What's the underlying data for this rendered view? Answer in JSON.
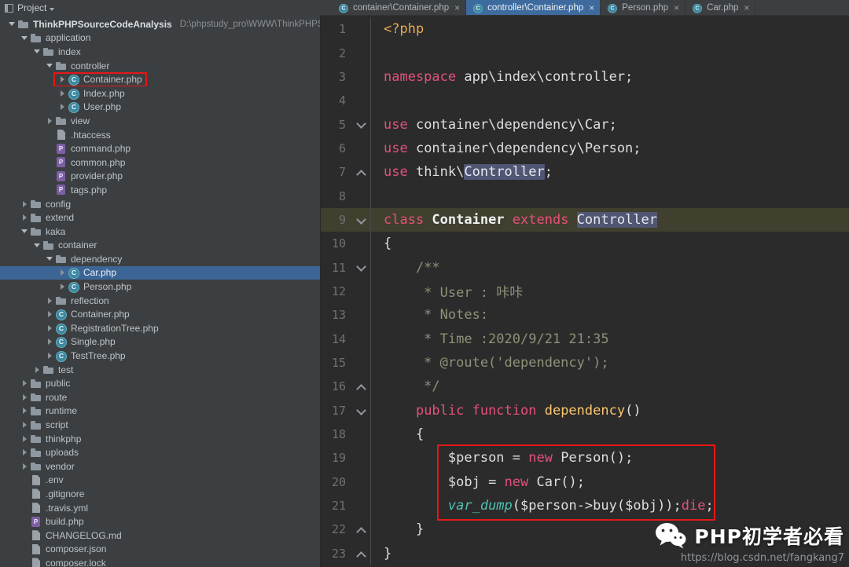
{
  "colors": {
    "editor_bg": "#2b2b2b",
    "panel_bg": "#3c3f41",
    "active_tab": "#3e6b9e",
    "tree_selection": "#3c6595",
    "current_line": "#413f2d",
    "occurrence": "#505673",
    "keyword": "#e4517b",
    "php_tag": "#e9a852",
    "comment": "#8f9178",
    "function_name": "#fdc66e",
    "builtin": "#4fc0b2",
    "code_text": "#dcdee1",
    "annotation_red": "#e61717"
  },
  "project_panel": {
    "title": "Project",
    "header_icons": [
      {
        "name": "locate-icon",
        "glyph": "⊙"
      },
      {
        "name": "collapse-all-icon",
        "glyph": "÷"
      },
      {
        "name": "settings-gear-icon",
        "glyph": "⚙"
      },
      {
        "name": "hide-panel-icon",
        "glyph": "—"
      }
    ]
  },
  "tabs": [
    {
      "label": "container\\Container.php",
      "active": false
    },
    {
      "label": "controller\\Container.php",
      "active": true
    },
    {
      "label": "Person.php",
      "active": false
    },
    {
      "label": "Car.php",
      "active": false
    }
  ],
  "tree": {
    "items": [
      {
        "label": "ThinkPHPSourceCodeAnalysis",
        "suffix": "D:\\phpstudy_pro\\WWW\\ThinkPHPSourceCo",
        "level": 0,
        "icon": "folder",
        "arrow": "down",
        "bold": true
      },
      {
        "label": "application",
        "level": 1,
        "icon": "folder",
        "arrow": "down"
      },
      {
        "label": "index",
        "level": 2,
        "icon": "folder",
        "arrow": "down"
      },
      {
        "label": "controller",
        "level": 3,
        "icon": "folder",
        "arrow": "down"
      },
      {
        "label": "Container.php",
        "level": 4,
        "icon": "class",
        "arrow": "right",
        "redbox": true
      },
      {
        "label": "Index.php",
        "level": 4,
        "icon": "class",
        "arrow": "right"
      },
      {
        "label": "User.php",
        "level": 4,
        "icon": "class",
        "arrow": "right"
      },
      {
        "label": "view",
        "level": 3,
        "icon": "folder",
        "arrow": "right"
      },
      {
        "label": ".htaccess",
        "level": 3,
        "icon": "file",
        "arrow": "none"
      },
      {
        "label": "command.php",
        "level": 3,
        "icon": "php",
        "arrow": "none"
      },
      {
        "label": "common.php",
        "level": 3,
        "icon": "php",
        "arrow": "none"
      },
      {
        "label": "provider.php",
        "level": 3,
        "icon": "php",
        "arrow": "none"
      },
      {
        "label": "tags.php",
        "level": 3,
        "icon": "php",
        "arrow": "none"
      },
      {
        "label": "config",
        "level": 1,
        "icon": "folder",
        "arrow": "right"
      },
      {
        "label": "extend",
        "level": 1,
        "icon": "folder",
        "arrow": "right"
      },
      {
        "label": "kaka",
        "level": 1,
        "icon": "folder",
        "arrow": "down"
      },
      {
        "label": "container",
        "level": 2,
        "icon": "folder",
        "arrow": "down"
      },
      {
        "label": "dependency",
        "level": 3,
        "icon": "folder",
        "arrow": "down"
      },
      {
        "label": "Car.php",
        "level": 4,
        "icon": "class",
        "arrow": "right",
        "selected": true
      },
      {
        "label": "Person.php",
        "level": 4,
        "icon": "class",
        "arrow": "right"
      },
      {
        "label": "reflection",
        "level": 3,
        "icon": "folder",
        "arrow": "right"
      },
      {
        "label": "Container.php",
        "level": 3,
        "icon": "class",
        "arrow": "right"
      },
      {
        "label": "RegistrationTree.php",
        "level": 3,
        "icon": "class",
        "arrow": "right"
      },
      {
        "label": "Single.php",
        "level": 3,
        "icon": "class",
        "arrow": "right"
      },
      {
        "label": "TestTree.php",
        "level": 3,
        "icon": "class",
        "arrow": "right"
      },
      {
        "label": "test",
        "level": 2,
        "icon": "folder",
        "arrow": "right"
      },
      {
        "label": "public",
        "level": 1,
        "icon": "folder",
        "arrow": "right"
      },
      {
        "label": "route",
        "level": 1,
        "icon": "folder",
        "arrow": "right"
      },
      {
        "label": "runtime",
        "level": 1,
        "icon": "folder",
        "arrow": "right"
      },
      {
        "label": "script",
        "level": 1,
        "icon": "folder",
        "arrow": "right"
      },
      {
        "label": "thinkphp",
        "level": 1,
        "icon": "folder",
        "arrow": "right"
      },
      {
        "label": "uploads",
        "level": 1,
        "icon": "folder",
        "arrow": "right"
      },
      {
        "label": "vendor",
        "level": 1,
        "icon": "folder",
        "arrow": "right"
      },
      {
        "label": ".env",
        "level": 1,
        "icon": "file",
        "arrow": "none"
      },
      {
        "label": ".gitignore",
        "level": 1,
        "icon": "file",
        "arrow": "none"
      },
      {
        "label": ".travis.yml",
        "level": 1,
        "icon": "file",
        "arrow": "none"
      },
      {
        "label": "build.php",
        "level": 1,
        "icon": "php",
        "arrow": "none"
      },
      {
        "label": "CHANGELOG.md",
        "level": 1,
        "icon": "file",
        "arrow": "none"
      },
      {
        "label": "composer.json",
        "level": 1,
        "icon": "file",
        "arrow": "none"
      },
      {
        "label": "composer.lock",
        "level": 1,
        "icon": "file",
        "arrow": "none"
      }
    ]
  },
  "editor": {
    "lines": [
      {
        "n": "1",
        "fold": "",
        "tokens": [
          {
            "t": "<?php",
            "c": "php"
          }
        ]
      },
      {
        "n": "2",
        "fold": "",
        "tokens": []
      },
      {
        "n": "3",
        "fold": "",
        "tokens": [
          {
            "t": "namespace ",
            "c": "kw"
          },
          {
            "t": "app\\index\\controller;",
            "c": "pl"
          }
        ]
      },
      {
        "n": "4",
        "fold": "",
        "tokens": []
      },
      {
        "n": "5",
        "fold": "down",
        "tokens": [
          {
            "t": "use ",
            "c": "kw"
          },
          {
            "t": "container\\dependency\\Car;",
            "c": "pl"
          }
        ]
      },
      {
        "n": "6",
        "fold": "",
        "tokens": [
          {
            "t": "use ",
            "c": "kw"
          },
          {
            "t": "container\\dependency\\Person;",
            "c": "pl"
          }
        ]
      },
      {
        "n": "7",
        "fold": "up",
        "tokens": [
          {
            "t": "use ",
            "c": "kw"
          },
          {
            "t": "think\\",
            "c": "pl"
          },
          {
            "t": "Controller",
            "c": "occ"
          },
          {
            "t": ";",
            "c": "pl"
          }
        ]
      },
      {
        "n": "8",
        "fold": "",
        "tokens": []
      },
      {
        "n": "9",
        "fold": "down",
        "cur": true,
        "tokens": [
          {
            "t": "class ",
            "c": "kw"
          },
          {
            "t": "Container ",
            "c": "cls"
          },
          {
            "t": "extends ",
            "c": "kw"
          },
          {
            "t": "Controller",
            "c": "occ"
          }
        ]
      },
      {
        "n": "10",
        "fold": "",
        "tokens": [
          {
            "t": "{",
            "c": "pl"
          }
        ]
      },
      {
        "n": "11",
        "fold": "down",
        "tokens": [
          {
            "t": "    /**",
            "c": "cm"
          }
        ]
      },
      {
        "n": "12",
        "fold": "",
        "tokens": [
          {
            "t": "     * User : 咔咔",
            "c": "cm"
          }
        ]
      },
      {
        "n": "13",
        "fold": "",
        "tokens": [
          {
            "t": "     * Notes:",
            "c": "cm"
          }
        ]
      },
      {
        "n": "14",
        "fold": "",
        "tokens": [
          {
            "t": "     * Time :2020/9/21 21:35",
            "c": "cm"
          }
        ]
      },
      {
        "n": "15",
        "fold": "",
        "tokens": [
          {
            "t": "     * @route('dependency');",
            "c": "cm"
          }
        ]
      },
      {
        "n": "16",
        "fold": "up",
        "tokens": [
          {
            "t": "     */",
            "c": "cm"
          }
        ]
      },
      {
        "n": "17",
        "fold": "down",
        "tokens": [
          {
            "t": "    ",
            "c": "pl"
          },
          {
            "t": "public function ",
            "c": "kw"
          },
          {
            "t": "dependency",
            "c": "fn"
          },
          {
            "t": "()",
            "c": "pl"
          }
        ]
      },
      {
        "n": "18",
        "fold": "",
        "tokens": [
          {
            "t": "    {",
            "c": "pl"
          }
        ]
      },
      {
        "n": "19",
        "fold": "",
        "tokens": [
          {
            "t": "        ",
            "c": "pl"
          },
          {
            "t": "$person ",
            "c": "var"
          },
          {
            "t": "= ",
            "c": "pl"
          },
          {
            "t": "new ",
            "c": "kw"
          },
          {
            "t": "Person();",
            "c": "pl"
          }
        ]
      },
      {
        "n": "20",
        "fold": "",
        "tokens": [
          {
            "t": "        ",
            "c": "pl"
          },
          {
            "t": "$obj ",
            "c": "var"
          },
          {
            "t": "= ",
            "c": "pl"
          },
          {
            "t": "new ",
            "c": "kw"
          },
          {
            "t": "Car();",
            "c": "pl"
          }
        ]
      },
      {
        "n": "21",
        "fold": "",
        "tokens": [
          {
            "t": "        ",
            "c": "pl"
          },
          {
            "t": "var_dump",
            "c": "bi"
          },
          {
            "t": "(",
            "c": "pl"
          },
          {
            "t": "$person",
            "c": "var"
          },
          {
            "t": "->buy(",
            "c": "pl"
          },
          {
            "t": "$obj",
            "c": "var"
          },
          {
            "t": "));",
            "c": "pl"
          },
          {
            "t": "die",
            "c": "kw"
          },
          {
            "t": ";",
            "c": "pl"
          }
        ]
      },
      {
        "n": "22",
        "fold": "up",
        "tokens": [
          {
            "t": "    }",
            "c": "pl"
          }
        ]
      },
      {
        "n": "23",
        "fold": "up",
        "tokens": [
          {
            "t": "}",
            "c": "pl"
          }
        ]
      }
    ]
  },
  "watermark": {
    "title": "PHP初学者必看",
    "url": "https://blog.csdn.net/fangkang7"
  }
}
